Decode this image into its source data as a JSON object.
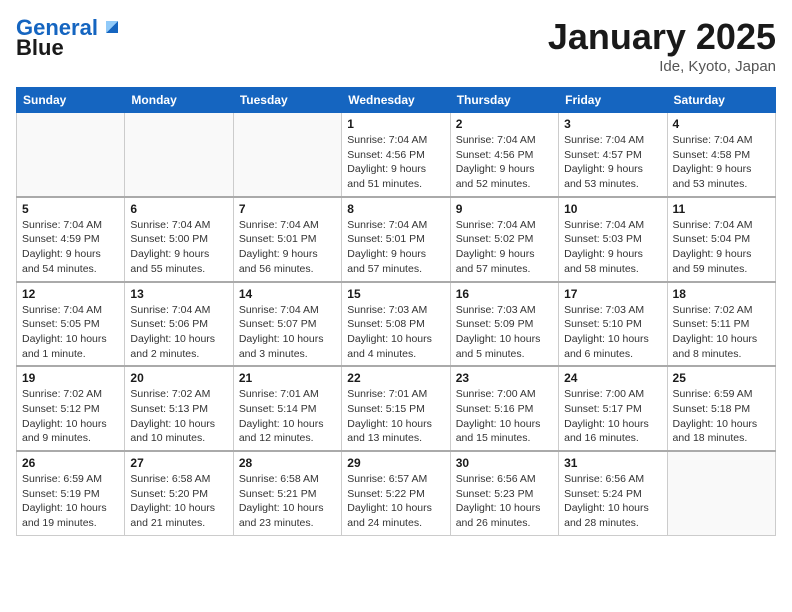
{
  "header": {
    "logo_line1": "General",
    "logo_line2": "Blue",
    "month": "January 2025",
    "location": "Ide, Kyoto, Japan"
  },
  "weekdays": [
    "Sunday",
    "Monday",
    "Tuesday",
    "Wednesday",
    "Thursday",
    "Friday",
    "Saturday"
  ],
  "weeks": [
    [
      {
        "day": "",
        "info": ""
      },
      {
        "day": "",
        "info": ""
      },
      {
        "day": "",
        "info": ""
      },
      {
        "day": "1",
        "info": "Sunrise: 7:04 AM\nSunset: 4:56 PM\nDaylight: 9 hours and 51 minutes."
      },
      {
        "day": "2",
        "info": "Sunrise: 7:04 AM\nSunset: 4:56 PM\nDaylight: 9 hours and 52 minutes."
      },
      {
        "day": "3",
        "info": "Sunrise: 7:04 AM\nSunset: 4:57 PM\nDaylight: 9 hours and 53 minutes."
      },
      {
        "day": "4",
        "info": "Sunrise: 7:04 AM\nSunset: 4:58 PM\nDaylight: 9 hours and 53 minutes."
      }
    ],
    [
      {
        "day": "5",
        "info": "Sunrise: 7:04 AM\nSunset: 4:59 PM\nDaylight: 9 hours and 54 minutes."
      },
      {
        "day": "6",
        "info": "Sunrise: 7:04 AM\nSunset: 5:00 PM\nDaylight: 9 hours and 55 minutes."
      },
      {
        "day": "7",
        "info": "Sunrise: 7:04 AM\nSunset: 5:01 PM\nDaylight: 9 hours and 56 minutes."
      },
      {
        "day": "8",
        "info": "Sunrise: 7:04 AM\nSunset: 5:01 PM\nDaylight: 9 hours and 57 minutes."
      },
      {
        "day": "9",
        "info": "Sunrise: 7:04 AM\nSunset: 5:02 PM\nDaylight: 9 hours and 57 minutes."
      },
      {
        "day": "10",
        "info": "Sunrise: 7:04 AM\nSunset: 5:03 PM\nDaylight: 9 hours and 58 minutes."
      },
      {
        "day": "11",
        "info": "Sunrise: 7:04 AM\nSunset: 5:04 PM\nDaylight: 9 hours and 59 minutes."
      }
    ],
    [
      {
        "day": "12",
        "info": "Sunrise: 7:04 AM\nSunset: 5:05 PM\nDaylight: 10 hours and 1 minute."
      },
      {
        "day": "13",
        "info": "Sunrise: 7:04 AM\nSunset: 5:06 PM\nDaylight: 10 hours and 2 minutes."
      },
      {
        "day": "14",
        "info": "Sunrise: 7:04 AM\nSunset: 5:07 PM\nDaylight: 10 hours and 3 minutes."
      },
      {
        "day": "15",
        "info": "Sunrise: 7:03 AM\nSunset: 5:08 PM\nDaylight: 10 hours and 4 minutes."
      },
      {
        "day": "16",
        "info": "Sunrise: 7:03 AM\nSunset: 5:09 PM\nDaylight: 10 hours and 5 minutes."
      },
      {
        "day": "17",
        "info": "Sunrise: 7:03 AM\nSunset: 5:10 PM\nDaylight: 10 hours and 6 minutes."
      },
      {
        "day": "18",
        "info": "Sunrise: 7:02 AM\nSunset: 5:11 PM\nDaylight: 10 hours and 8 minutes."
      }
    ],
    [
      {
        "day": "19",
        "info": "Sunrise: 7:02 AM\nSunset: 5:12 PM\nDaylight: 10 hours and 9 minutes."
      },
      {
        "day": "20",
        "info": "Sunrise: 7:02 AM\nSunset: 5:13 PM\nDaylight: 10 hours and 10 minutes."
      },
      {
        "day": "21",
        "info": "Sunrise: 7:01 AM\nSunset: 5:14 PM\nDaylight: 10 hours and 12 minutes."
      },
      {
        "day": "22",
        "info": "Sunrise: 7:01 AM\nSunset: 5:15 PM\nDaylight: 10 hours and 13 minutes."
      },
      {
        "day": "23",
        "info": "Sunrise: 7:00 AM\nSunset: 5:16 PM\nDaylight: 10 hours and 15 minutes."
      },
      {
        "day": "24",
        "info": "Sunrise: 7:00 AM\nSunset: 5:17 PM\nDaylight: 10 hours and 16 minutes."
      },
      {
        "day": "25",
        "info": "Sunrise: 6:59 AM\nSunset: 5:18 PM\nDaylight: 10 hours and 18 minutes."
      }
    ],
    [
      {
        "day": "26",
        "info": "Sunrise: 6:59 AM\nSunset: 5:19 PM\nDaylight: 10 hours and 19 minutes."
      },
      {
        "day": "27",
        "info": "Sunrise: 6:58 AM\nSunset: 5:20 PM\nDaylight: 10 hours and 21 minutes."
      },
      {
        "day": "28",
        "info": "Sunrise: 6:58 AM\nSunset: 5:21 PM\nDaylight: 10 hours and 23 minutes."
      },
      {
        "day": "29",
        "info": "Sunrise: 6:57 AM\nSunset: 5:22 PM\nDaylight: 10 hours and 24 minutes."
      },
      {
        "day": "30",
        "info": "Sunrise: 6:56 AM\nSunset: 5:23 PM\nDaylight: 10 hours and 26 minutes."
      },
      {
        "day": "31",
        "info": "Sunrise: 6:56 AM\nSunset: 5:24 PM\nDaylight: 10 hours and 28 minutes."
      },
      {
        "day": "",
        "info": ""
      }
    ]
  ]
}
